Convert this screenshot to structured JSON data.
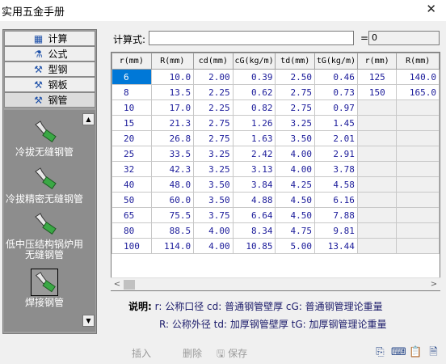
{
  "window": {
    "title": "实用五金手册",
    "close_glyph": "✕"
  },
  "formula": {
    "label": "计算式:",
    "value": "",
    "equals": "=",
    "result": "0"
  },
  "nav": {
    "buttons": [
      {
        "label": "计算",
        "icon": "calculator-icon",
        "glyph": "▦"
      },
      {
        "label": "公式",
        "icon": "formula-icon",
        "glyph": "⚗"
      },
      {
        "label": "型钢",
        "icon": "profile-steel-icon",
        "glyph": "⚒"
      },
      {
        "label": "钢板",
        "icon": "steel-plate-icon",
        "glyph": "⚒"
      },
      {
        "label": "钢管",
        "icon": "steel-pipe-icon",
        "glyph": "⚒"
      }
    ],
    "items": [
      {
        "label": "冷拔无缝钢管"
      },
      {
        "label": "冷拔精密无缝钢管"
      },
      {
        "label": "低中压结构锅炉用无缝钢管"
      },
      {
        "label": "焊接钢管"
      }
    ],
    "scroll_up_glyph": "▲",
    "scroll_down_glyph": "▼"
  },
  "table": {
    "columns": [
      "r(mm)",
      "R(mm)",
      "cd(mm)",
      "cG(kg/m)",
      "td(mm)",
      "tG(kg/m)",
      "r(mm)",
      "R(mm)"
    ],
    "rows": [
      [
        "6",
        "10.0",
        "2.00",
        "0.39",
        "2.50",
        "0.46",
        "125",
        "140.0"
      ],
      [
        "8",
        "13.5",
        "2.25",
        "0.62",
        "2.75",
        "0.73",
        "150",
        "165.0"
      ],
      [
        "10",
        "17.0",
        "2.25",
        "0.82",
        "2.75",
        "0.97",
        "",
        ""
      ],
      [
        "15",
        "21.3",
        "2.75",
        "1.26",
        "3.25",
        "1.45",
        "",
        ""
      ],
      [
        "20",
        "26.8",
        "2.75",
        "1.63",
        "3.50",
        "2.01",
        "",
        ""
      ],
      [
        "25",
        "33.5",
        "3.25",
        "2.42",
        "4.00",
        "2.91",
        "",
        ""
      ],
      [
        "32",
        "42.3",
        "3.25",
        "3.13",
        "4.00",
        "3.78",
        "",
        ""
      ],
      [
        "40",
        "48.0",
        "3.50",
        "3.84",
        "4.25",
        "4.58",
        "",
        ""
      ],
      [
        "50",
        "60.0",
        "3.50",
        "4.88",
        "4.50",
        "6.16",
        "",
        ""
      ],
      [
        "65",
        "75.5",
        "3.75",
        "6.64",
        "4.50",
        "7.88",
        "",
        ""
      ],
      [
        "80",
        "88.5",
        "4.00",
        "8.34",
        "4.75",
        "9.81",
        "",
        ""
      ],
      [
        "100",
        "114.0",
        "4.00",
        "10.85",
        "5.00",
        "13.44",
        "",
        ""
      ]
    ],
    "selected_cell": "6",
    "scroll_left_glyph": "<",
    "scroll_right_glyph": ">"
  },
  "legend": {
    "title": "说明:",
    "line1": "r: 公称口径  cd: 普通钢管壁厚  cG: 普通钢管理论重量",
    "line2": "R: 公称外径  td: 加厚钢管壁厚  tG: 加厚钢管理论重量"
  },
  "toolbar": {
    "insert": "插入",
    "delete": "删除",
    "save": "保存",
    "icons": [
      "copy-icon",
      "keyboard-icon",
      "clipboard-icon",
      "document-icon"
    ],
    "save_glyph": "🖫"
  },
  "colors": {
    "selection": "#0078d7",
    "value_text": "#1b1b9a",
    "nav_panel": "#8d8d8d"
  }
}
